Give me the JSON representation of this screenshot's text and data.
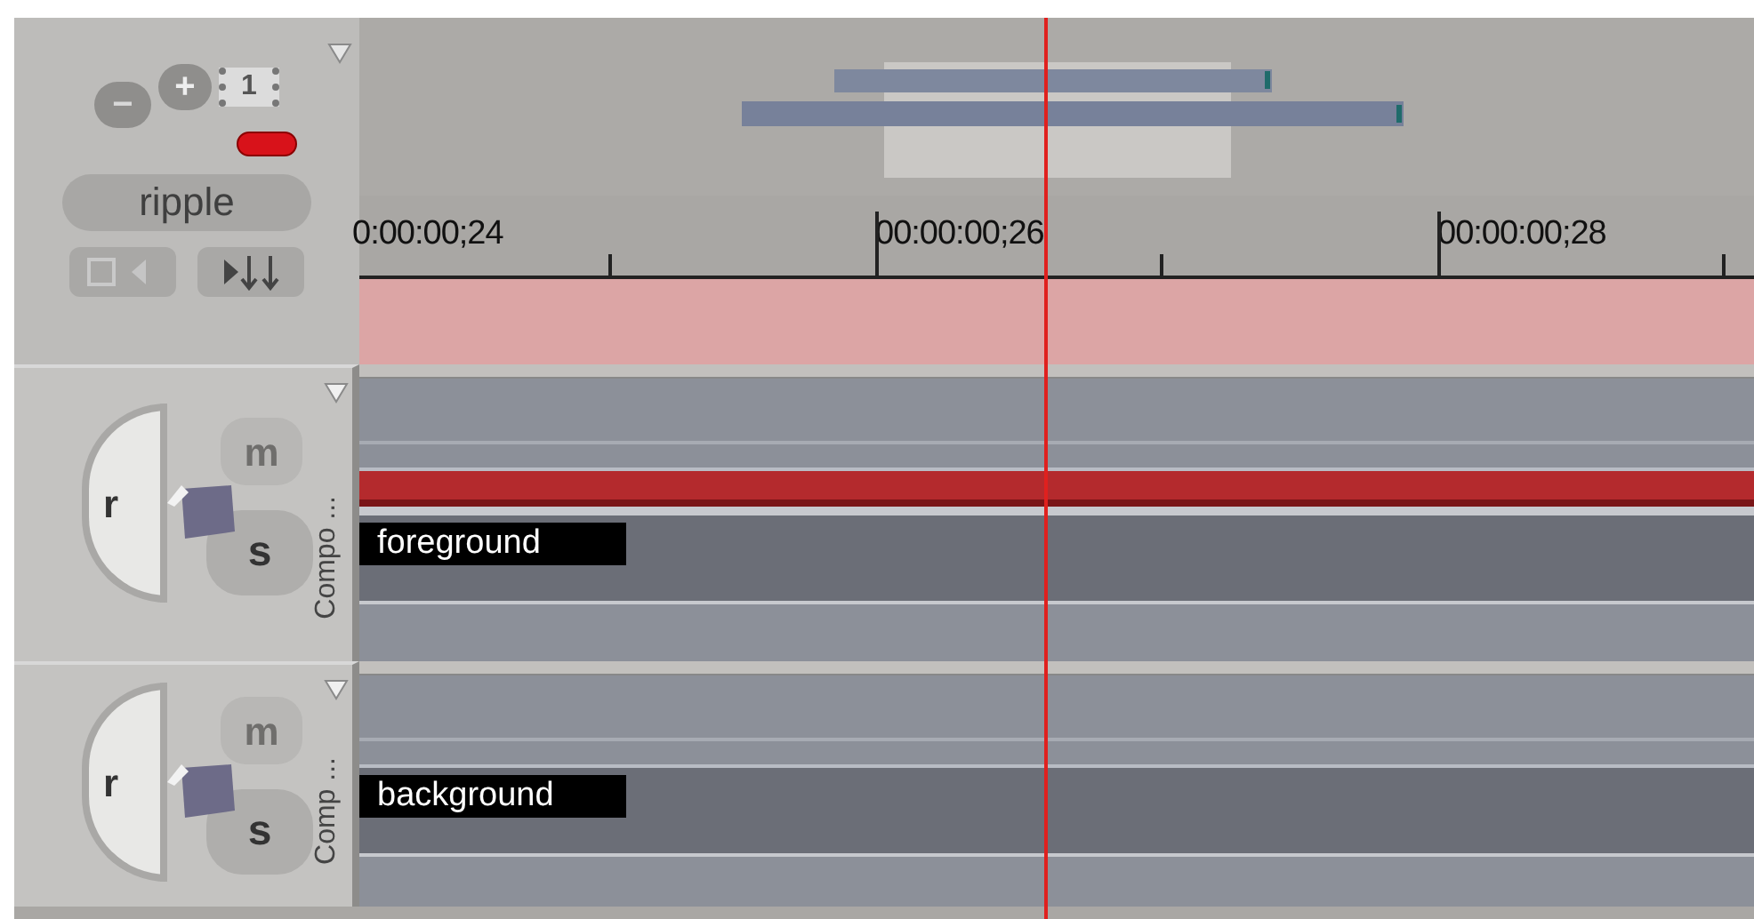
{
  "zoom_controls": {
    "zoom_out": "−",
    "zoom_in": "+",
    "frame": "1"
  },
  "mode_button": {
    "label": "ripple"
  },
  "ruler": {
    "labels": [
      {
        "text": "0:00:00;24"
      },
      {
        "text": "00:00:00;26"
      },
      {
        "text": "00:00:00;28"
      }
    ]
  },
  "playhead": {
    "level": 0.491
  },
  "tracks": [
    {
      "name": "foreground",
      "title": "Compo ...",
      "selected": true,
      "buttons": [
        "r",
        "m",
        "s"
      ]
    },
    {
      "name": "background",
      "title": "Comp ...",
      "selected": false,
      "buttons": [
        "r",
        "m",
        "s"
      ]
    }
  ]
}
